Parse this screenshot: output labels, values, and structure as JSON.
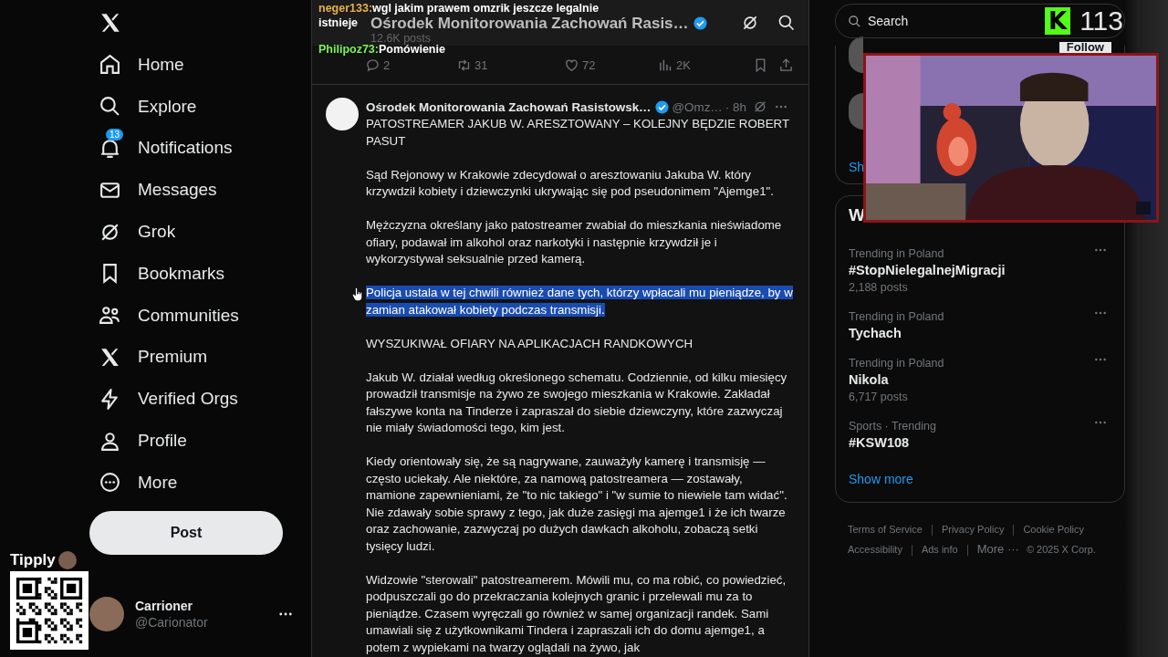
{
  "sidebar": {
    "items": [
      {
        "label": "Home",
        "selected": false
      },
      {
        "label": "Explore",
        "selected": false
      },
      {
        "label": "Notifications",
        "selected": false,
        "badge": "13"
      },
      {
        "label": "Messages",
        "selected": false
      },
      {
        "label": "Grok",
        "selected": false
      },
      {
        "label": "Bookmarks",
        "selected": false
      },
      {
        "label": "Communities",
        "selected": false
      },
      {
        "label": "Premium",
        "selected": false
      },
      {
        "label": "Verified Orgs",
        "selected": false
      },
      {
        "label": "Profile",
        "selected": false
      },
      {
        "label": "More",
        "selected": false
      }
    ],
    "post_button": "Post",
    "account": {
      "name": "Carrioner",
      "handle": "@Carionator"
    }
  },
  "tipply": {
    "label": "Tipply"
  },
  "header": {
    "title": "Ośrodek Monitorowania Zachowań Rasis…",
    "subtitle": "12.6K posts"
  },
  "chat": [
    {
      "user": "neger133:",
      "color": "#e8b04a",
      "message": "wgl jakim prawem omzrik jeszcze legalnie"
    },
    {
      "message": "istnieje"
    },
    {
      "user": "Philipoz73:",
      "color": "#7cf25a",
      "message": "Pomówienie"
    }
  ],
  "previous_post_actions": [
    {
      "kind": "reply",
      "count": "2"
    },
    {
      "kind": "repost",
      "count": "31"
    },
    {
      "kind": "like",
      "count": "72"
    },
    {
      "kind": "views",
      "count": "2K"
    },
    {
      "kind": "bookmark"
    },
    {
      "kind": "share"
    }
  ],
  "post": {
    "name": "Ośrodek Monitorowania Zachowań Rasistowsk…",
    "handle": "@Omz…",
    "time": "· 8h",
    "paragraphs": [
      {
        "text": "PATOSTREAMER JAKUB W. ARESZTOWANY – KOLEJNY BĘDZIE ROBERT PASUT",
        "selected": false
      },
      {
        "text": "Sąd Rejonowy w Krakowie zdecydował o aresztowaniu Jakuba W. który krzywdził kobiety i dziewczynki ukrywając się pod pseudonimem \"Ajemge1\".",
        "selected": false
      },
      {
        "text": "Mężczyzna określany jako patostreamer zwabiał do mieszkania nieświadome ofiary, podawał im alkohol oraz narkotyki i następnie krzywdził je i wykorzystywał  seksualnie przed kamerą.",
        "selected": false
      },
      {
        "text": "Policja ustala w tej chwili również dane tych, którzy wpłacali mu pieniądze, by w zamian atakował kobiety podczas transmisji.",
        "selected": true
      },
      {
        "text": "WYSZUKIWAŁ OFIARY NA APLIKACJACH RANDKOWYCH",
        "selected": false
      },
      {
        "text": "Jakub W. działał według określonego schematu. Codziennie, od kilku miesięcy prowadził transmisje na żywo ze swojego mieszkania w Krakowie. Zakładał fałszywe konta na Tinderze i zapraszał do siebie dziewczyny, które zazwyczaj nie miały świadomości tego, kim jest.",
        "selected": false
      },
      {
        "text": "Kiedy orientowały się, że są nagrywane, zauważyły kamerę i transmisję — często uciekały. Ale niektóre, za namową patostreamera — zostawały, mamione zapewnieniami, że \"to nic takiego\" i \"w sumie to niewiele tam widać\". Nie zdawały sobie sprawy z tego, jak duże zasięgi ma ajemge1 i że ich twarze oraz zachowanie, zazwyczaj po dużych dawkach alkoholu, zobaczą setki tysięcy ludzi.",
        "selected": false
      },
      {
        "text": "Widzowie \"sterowali\" patostreamerem. Mówili mu, co ma robić, co powiedzieć, podpuszczali go do przekraczania kolejnych granic i przelewali mu za to pieniądze. Czasem wyręczali go również w samej organizacji randek. Sami umawiali się z użytkownikami Tindera i zapraszali ich do domu ajemge1, a potem z wypiekami na twarzy oglądali na żywo, jak",
        "selected": false
      }
    ]
  },
  "search": {
    "placeholder": "Search"
  },
  "kick": {
    "logo": "K",
    "count": "113"
  },
  "follow_card": {
    "button": "Follow",
    "link": "Sh"
  },
  "trends": {
    "heading": "W",
    "items": [
      {
        "context": "Trending in Poland",
        "name": "#StopNielegalnejMigracji",
        "posts": "2,188 posts"
      },
      {
        "context": "Trending in Poland",
        "name": "Tychach"
      },
      {
        "context": "Trending in Poland",
        "name": "Nikola",
        "posts": "6,717 posts"
      },
      {
        "context": "Sports · Trending",
        "name": "#KSW108"
      }
    ],
    "show_more": "Show more"
  },
  "footer": {
    "links": [
      "Terms of Service",
      "Privacy Policy",
      "Cookie Policy",
      "Accessibility",
      "Ads info"
    ],
    "more": "More ···",
    "copyright": "© 2025 X Corp."
  }
}
